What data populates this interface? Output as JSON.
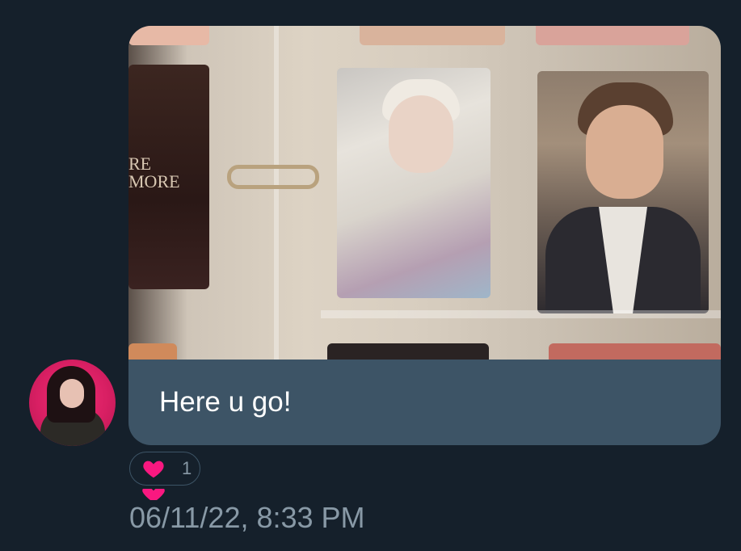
{
  "message": {
    "text": "Here u go!",
    "image_alt": "Photocard binder with two idol photocards",
    "card_text": "RE\nMORE"
  },
  "reactions": [
    {
      "emoji": "heart-icon",
      "count": "1"
    }
  ],
  "timestamp": "06/11/22, 8:33 PM",
  "colors": {
    "background": "#15202b",
    "bubble": "#3d5466",
    "text": "#ffffff",
    "muted": "#8899a6",
    "heart": "#f91880"
  }
}
